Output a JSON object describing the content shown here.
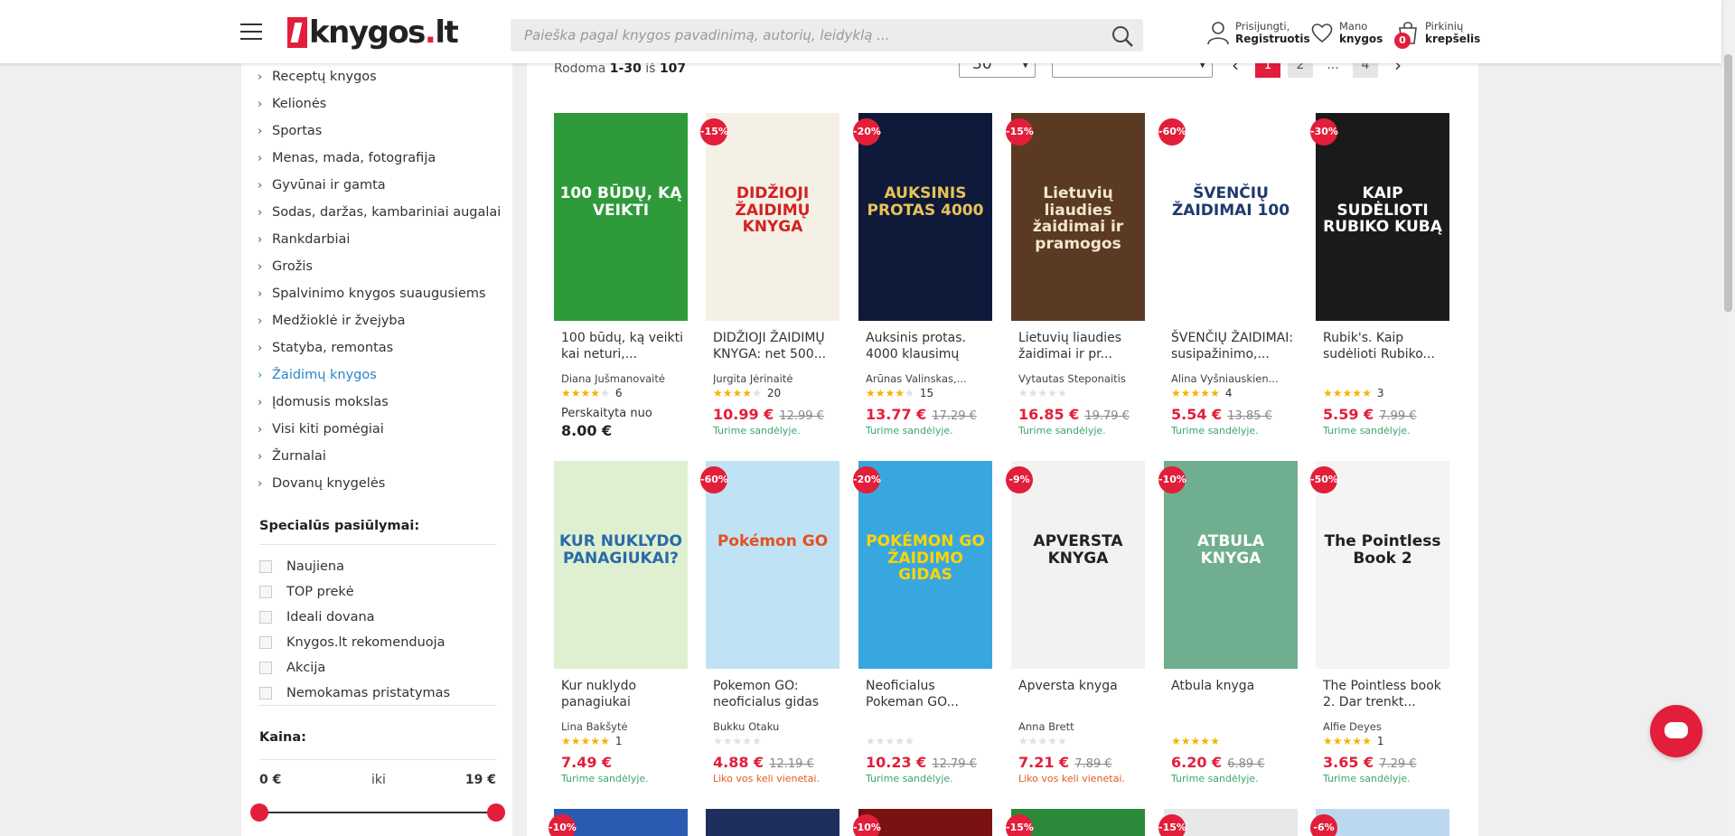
{
  "header": {
    "logo_text": "knygos",
    "logo_dot": ".",
    "logo_tld": "lt",
    "search_placeholder": "Paieška pagal knygos pavadinimą, autorių, leidyklą ...",
    "login_line1": "Prisijungti,",
    "login_line2": "Registruotis",
    "wishlist_line1": "Mano",
    "wishlist_line2": "knygos",
    "cart_line1": "Pirkinių",
    "cart_line2": "krepšelis",
    "cart_count": "0"
  },
  "sidebar": {
    "categories": [
      {
        "label": "Receptų knygos"
      },
      {
        "label": "Kelionės"
      },
      {
        "label": "Sportas"
      },
      {
        "label": "Menas, mada, fotografija"
      },
      {
        "label": "Gyvūnai ir gamta"
      },
      {
        "label": "Sodas, daržas, kambariniai augalai"
      },
      {
        "label": "Rankdarbiai"
      },
      {
        "label": "Grožis"
      },
      {
        "label": "Spalvinimo knygos suaugusiems"
      },
      {
        "label": "Medžioklė ir žvejyba"
      },
      {
        "label": "Statyba, remontas"
      },
      {
        "label": "Žaidimų knygos",
        "active": true
      },
      {
        "label": "Įdomusis mokslas"
      },
      {
        "label": "Visi kiti pomėgiai"
      },
      {
        "label": "Žurnalai"
      },
      {
        "label": "Dovanų knygelės"
      }
    ],
    "special_title": "Specialūs pasiūlymai:",
    "filters": [
      "Naujiena",
      "TOP prekė",
      "Ideali dovana",
      "Knygos.lt rekomenduoja",
      "Akcija",
      "Nemokamas pristatymas"
    ],
    "price_title": "Kaina:",
    "price_min": "0 €",
    "price_mid": "iki",
    "price_max": "19 €"
  },
  "toolbar": {
    "showing_prefix": "Rodoma",
    "showing_range": "1-30",
    "showing_of": "iš",
    "showing_total": "107",
    "per_page": "30",
    "sort": "",
    "pages": [
      "1",
      "2",
      "...",
      "4"
    ]
  },
  "products": [
    {
      "title": "100 būdų, ką veikti kai neturi,...",
      "author": "Diana Jušmanovaitė",
      "stars": 4,
      "reviews": "6",
      "read_label": "Perskaityta nuo",
      "read_price": "8.00 €",
      "badge": "",
      "cover_bg": "#2e9a3a",
      "cover_text": "100 BŪDŲ, KĄ VEIKTI",
      "cover_fg": "#ffffff"
    },
    {
      "title": "DIDŽIOJI ŽAIDIMŲ KNYGA: net 500...",
      "author": "Jurgita Jėrinaitė",
      "stars": 4,
      "reviews": "20",
      "price": "10.99 €",
      "old": "12.99 €",
      "stock": "Turime sandėlyje.",
      "badge": "-15%",
      "cover_bg": "#f4f0e6",
      "cover_text": "DIDŽIOJI ŽAIDIMŲ KNYGA",
      "cover_fg": "#d32222"
    },
    {
      "title": "Auksinis protas. 4000 klausimų",
      "author": "Arūnas Valinskas,...",
      "stars": 4,
      "reviews": "15",
      "price": "13.77 €",
      "old": "17.29 €",
      "stock": "Turime sandėlyje.",
      "badge": "-20%",
      "cover_bg": "#0f1a3a",
      "cover_text": "AUKSINIS PROTAS 4000",
      "cover_fg": "#e8c15a"
    },
    {
      "title": "Lietuvių liaudies žaidimai ir pr...",
      "author": "Vytautas Steponaitis",
      "stars": 0,
      "reviews": "",
      "price": "16.85 €",
      "old": "19.79 €",
      "stock": "Turime sandėlyje.",
      "badge": "-15%",
      "cover_bg": "#5a3a22",
      "cover_text": "Lietuvių liaudies žaidimai ir pramogos",
      "cover_fg": "#f2e6d0"
    },
    {
      "title": "ŠVENČIŲ ŽAIDIMAI: susipažinimo,...",
      "author": "Alina Vyšniauskien...",
      "stars": 5,
      "reviews": "4",
      "price": "5.54 €",
      "old": "13.85 €",
      "stock": "Turime sandėlyje.",
      "badge": "-60%",
      "cover_bg": "#ffffff",
      "cover_text": "ŠVENČIŲ ŽAIDIMAI 100",
      "cover_fg": "#1f3a6e"
    },
    {
      "title": "Rubik's. Kaip sudėlioti Rubiko...",
      "author": "",
      "stars": 5,
      "reviews": "3",
      "price": "5.59 €",
      "old": "7.99 €",
      "stock": "Turime sandėlyje.",
      "badge": "-30%",
      "cover_bg": "#1a1a1a",
      "cover_text": "KAIP SUDĖLIOTI RUBIKO KUBĄ",
      "cover_fg": "#ffffff"
    },
    {
      "title": "Kur nuklydo panagiukai",
      "author": "Lina Bakšytė",
      "stars": 5,
      "reviews": "1",
      "price": "7.49 €",
      "old": "",
      "stock": "Turime sandėlyje.",
      "badge": "",
      "cover_bg": "#dff0d0",
      "cover_text": "KUR NUKLYDO PANAGIUKAI?",
      "cover_fg": "#2a6aa8"
    },
    {
      "title": "Pokemon GO: neoficialus gidas",
      "author": "Bukku Otaku",
      "stars": 0,
      "reviews": "",
      "price": "4.88 €",
      "old": "12.19 €",
      "stock": "Liko vos keli vienetai.",
      "stock_low": true,
      "badge": "-60%",
      "cover_bg": "#bfe3f5",
      "cover_text": "Pokémon GO",
      "cover_fg": "#e5501f"
    },
    {
      "title": "Neoficialus Pokeman GO...",
      "author": "",
      "stars": 0,
      "reviews": "",
      "price": "10.23 €",
      "old": "12.79 €",
      "stock": "Turime sandėlyje.",
      "badge": "-20%",
      "cover_bg": "#39a7df",
      "cover_text": "POKÉMON GO ŽAIDIMO GIDAS",
      "cover_fg": "#ffd400"
    },
    {
      "title": "Apversta knyga",
      "author": "Anna Brett",
      "stars": 0,
      "reviews": "",
      "price": "7.21 €",
      "old": "7.89 €",
      "stock": "Liko vos keli vienetai.",
      "stock_low": true,
      "badge": "-9%",
      "cover_bg": "#f2f2f2",
      "cover_text": "APVERSTA KNYGA",
      "cover_fg": "#222222"
    },
    {
      "title": "Atbula knyga",
      "author": "",
      "stars": 5,
      "reviews": "",
      "price": "6.20 €",
      "old": "6.89 €",
      "stock": "Turime sandėlyje.",
      "badge": "-10%",
      "cover_bg": "#6fae8e",
      "cover_text": "ATBULA KNYGA",
      "cover_fg": "#ffffff"
    },
    {
      "title": "The Pointless book 2. Dar trenkt...",
      "author": "Alfie Deyes",
      "stars": 5,
      "reviews": "1",
      "price": "3.65 €",
      "old": "7.29 €",
      "stock": "Turime sandėlyje.",
      "badge": "-50%",
      "cover_bg": "#f4f4f4",
      "cover_text": "The Pointless Book 2",
      "cover_fg": "#222222"
    }
  ],
  "bottom_row_badges": [
    "-10%",
    "",
    "-10%",
    "-15%",
    "-15%",
    "-6%"
  ],
  "colors": {
    "accent": "#e31e3a",
    "link": "#2a86c7",
    "stock": "#3aa76d",
    "stock_low": "#e55a1c",
    "star": "#f5b301"
  }
}
